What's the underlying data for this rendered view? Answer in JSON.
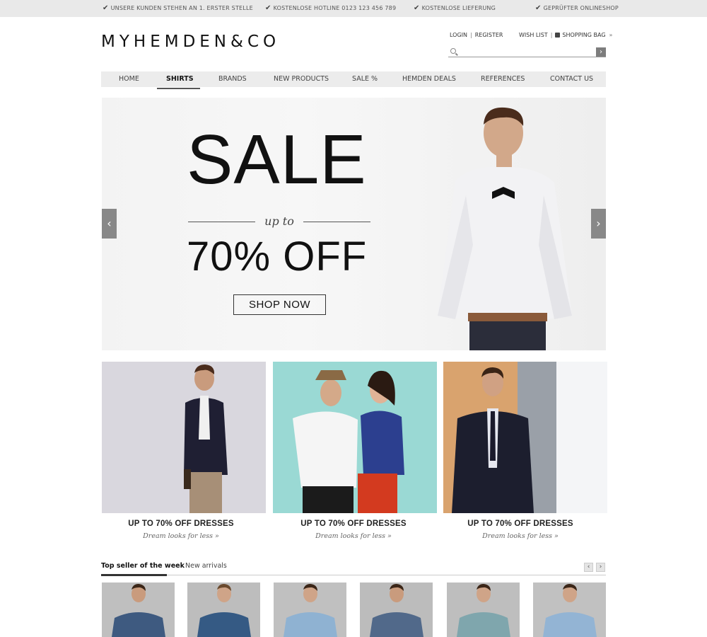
{
  "topbar": {
    "items": [
      "UNSERE KUNDEN STEHEN AN 1. ERSTER STELLE",
      "KOSTENLOSE HOTLINE 0123 123 456 789",
      "KOSTENLOSE LIEFERUNG",
      "GEPRÜFTER ONLINESHOP"
    ]
  },
  "header": {
    "logo": "MYHEMDEN&CO",
    "login": "LOGIN",
    "register": "REGISTER",
    "wishlist": "WISH LIST",
    "bag": "SHOPPING BAG",
    "search_placeholder": ""
  },
  "nav": {
    "items": [
      "HOME",
      "SHIRTS",
      "BRANDS",
      "NEW PRODUCTS",
      "SALE %",
      "HEMDEN DEALS",
      "REFERENCES",
      "CONTACT US"
    ],
    "active": "SHIRTS"
  },
  "hero": {
    "title": "SALE",
    "upto": "up to",
    "offer": "70% OFF",
    "button": "SHOP NOW"
  },
  "tiles": [
    {
      "title": "UP TO 70% OFF DRESSES",
      "subtitle": "Dream looks for less »"
    },
    {
      "title": "UP TO 70% OFF DRESSES",
      "subtitle": "Dream looks for less »"
    },
    {
      "title": "UP TO 70% OFF DRESSES",
      "subtitle": "Dream looks for less »"
    }
  ],
  "tabs": {
    "items": [
      "Top seller of the week",
      "New arrivals"
    ],
    "active": "Top seller of the week"
  },
  "colors": {
    "topbar_bg": "#e9e9e9",
    "nav_bg": "#ececec",
    "arrow_bg": "#888888",
    "text_dark": "#111111"
  }
}
